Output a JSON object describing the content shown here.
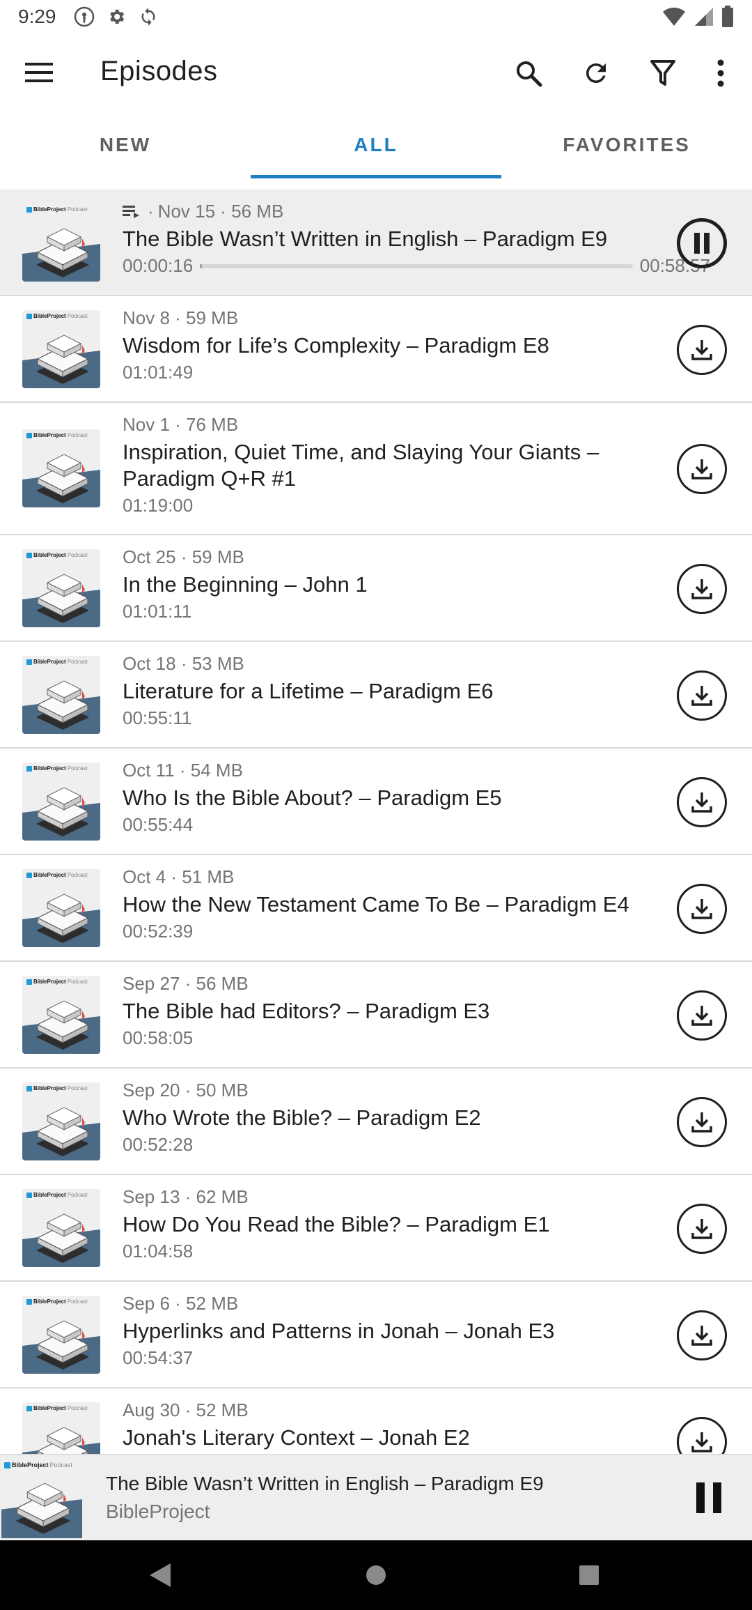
{
  "status_bar": {
    "time": "9:29",
    "icons": [
      "hotspot-icon",
      "settings-icon",
      "sync-icon",
      "wifi-icon",
      "signal-icon",
      "battery-icon"
    ]
  },
  "toolbar": {
    "title": "Episodes",
    "actions": [
      "search-icon",
      "refresh-icon",
      "filter-icon",
      "more-icon"
    ]
  },
  "tabs": [
    {
      "label": "NEW",
      "active": false
    },
    {
      "label": "ALL",
      "active": true
    },
    {
      "label": "FAVORITES",
      "active": false
    }
  ],
  "podcast_art": {
    "brand": "BibleProject",
    "suffix": "Podcast"
  },
  "episodes": [
    {
      "meta": "Nov 15 · 56 MB",
      "title": "The Bible Wasn’t Written in English – Paradigm E9",
      "position": "00:00:16",
      "duration": "00:58:57",
      "progress_fraction": 0.005,
      "queued": true,
      "state": "playing"
    },
    {
      "meta": "Nov 8 · 59 MB",
      "title": "Wisdom for Life’s Complexity – Paradigm E8",
      "duration": "01:01:49",
      "state": "download"
    },
    {
      "meta": "Nov 1 · 76 MB",
      "title": "Inspiration, Quiet Time, and Slaying Your Giants – Paradigm Q+R #1",
      "duration": "01:19:00",
      "state": "download"
    },
    {
      "meta": "Oct 25 · 59 MB",
      "title": "In the Beginning – John 1",
      "duration": "01:01:11",
      "state": "download"
    },
    {
      "meta": "Oct 18 · 53 MB",
      "title": "Literature for a Lifetime – Paradigm E6",
      "duration": "00:55:11",
      "state": "download"
    },
    {
      "meta": "Oct 11 · 54 MB",
      "title": "Who Is the Bible About? – Paradigm E5",
      "duration": "00:55:44",
      "state": "download"
    },
    {
      "meta": "Oct 4 · 51 MB",
      "title": "How the New Testament Came To Be – Paradigm E4",
      "duration": "00:52:39",
      "state": "download"
    },
    {
      "meta": "Sep 27 · 56 MB",
      "title": "The Bible had Editors? – Paradigm E3",
      "duration": "00:58:05",
      "state": "download"
    },
    {
      "meta": "Sep 20 · 50 MB",
      "title": "Who Wrote the Bible? – Paradigm E2",
      "duration": "00:52:28",
      "state": "download"
    },
    {
      "meta": "Sep 13 · 62 MB",
      "title": "How Do You Read the Bible? – Paradigm E1",
      "duration": "01:04:58",
      "state": "download"
    },
    {
      "meta": "Sep 6 · 52 MB",
      "title": "Hyperlinks and Patterns in Jonah – Jonah E3",
      "duration": "00:54:37",
      "state": "download"
    },
    {
      "meta": "Aug 30 · 52 MB",
      "title": "Jonah's Literary Context – Jonah E2",
      "duration": "",
      "state": "download"
    }
  ],
  "mini_player": {
    "title": "The Bible Wasn’t Written in English – Paradigm E9",
    "artist": "BibleProject",
    "control": "pause-icon"
  },
  "colors": {
    "accent": "#1e7fc4",
    "playing_row_bg": "#eeeeee",
    "text_primary": "#1f1f1f",
    "text_secondary": "#757575",
    "art_blue": "#4b6a86",
    "art_logo": "#1f9ad6"
  }
}
